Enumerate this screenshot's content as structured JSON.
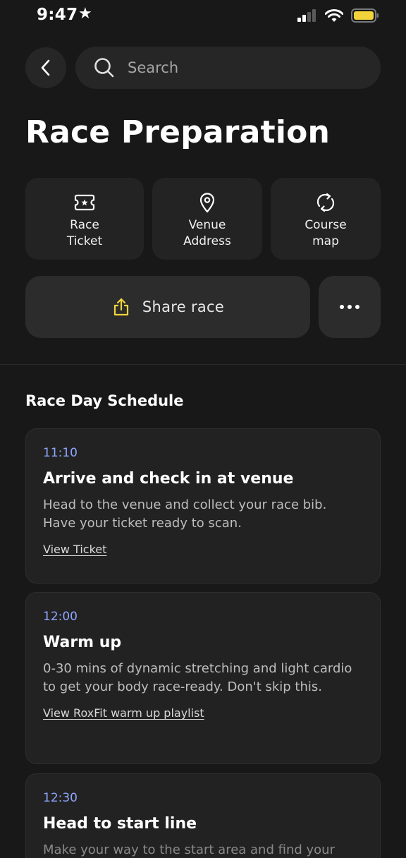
{
  "status_bar": {
    "time": "9:47"
  },
  "search": {
    "placeholder": "Search"
  },
  "page": {
    "title": "Race Preparation"
  },
  "tiles": [
    {
      "label": "Race\nTicket",
      "icon": "ticket-icon"
    },
    {
      "label": "Venue\nAddress",
      "icon": "location-pin-icon"
    },
    {
      "label": "Course\nmap",
      "icon": "loop-arrows-icon"
    }
  ],
  "share": {
    "label": "Share race",
    "icon_color": "#f2d43a"
  },
  "schedule": {
    "title": "Race Day Schedule",
    "items": [
      {
        "time": "11:10",
        "title": "Arrive and check in at venue",
        "description": "Head to the venue and collect your race bib. Have your ticket ready to scan.",
        "link": "View Ticket"
      },
      {
        "time": "12:00",
        "title": "Warm up",
        "description": "0-30 mins of dynamic stretching and light cardio to get your body race-ready. Don't skip this.",
        "link": "View RoxFit warm up playlist"
      },
      {
        "time": "12:30",
        "title": "Head to start line",
        "description": "Make your way to the start area and find your"
      }
    ]
  },
  "colors": {
    "accent_time": "#8fa6ff",
    "battery": "#f2d43a",
    "background": "#181818"
  }
}
